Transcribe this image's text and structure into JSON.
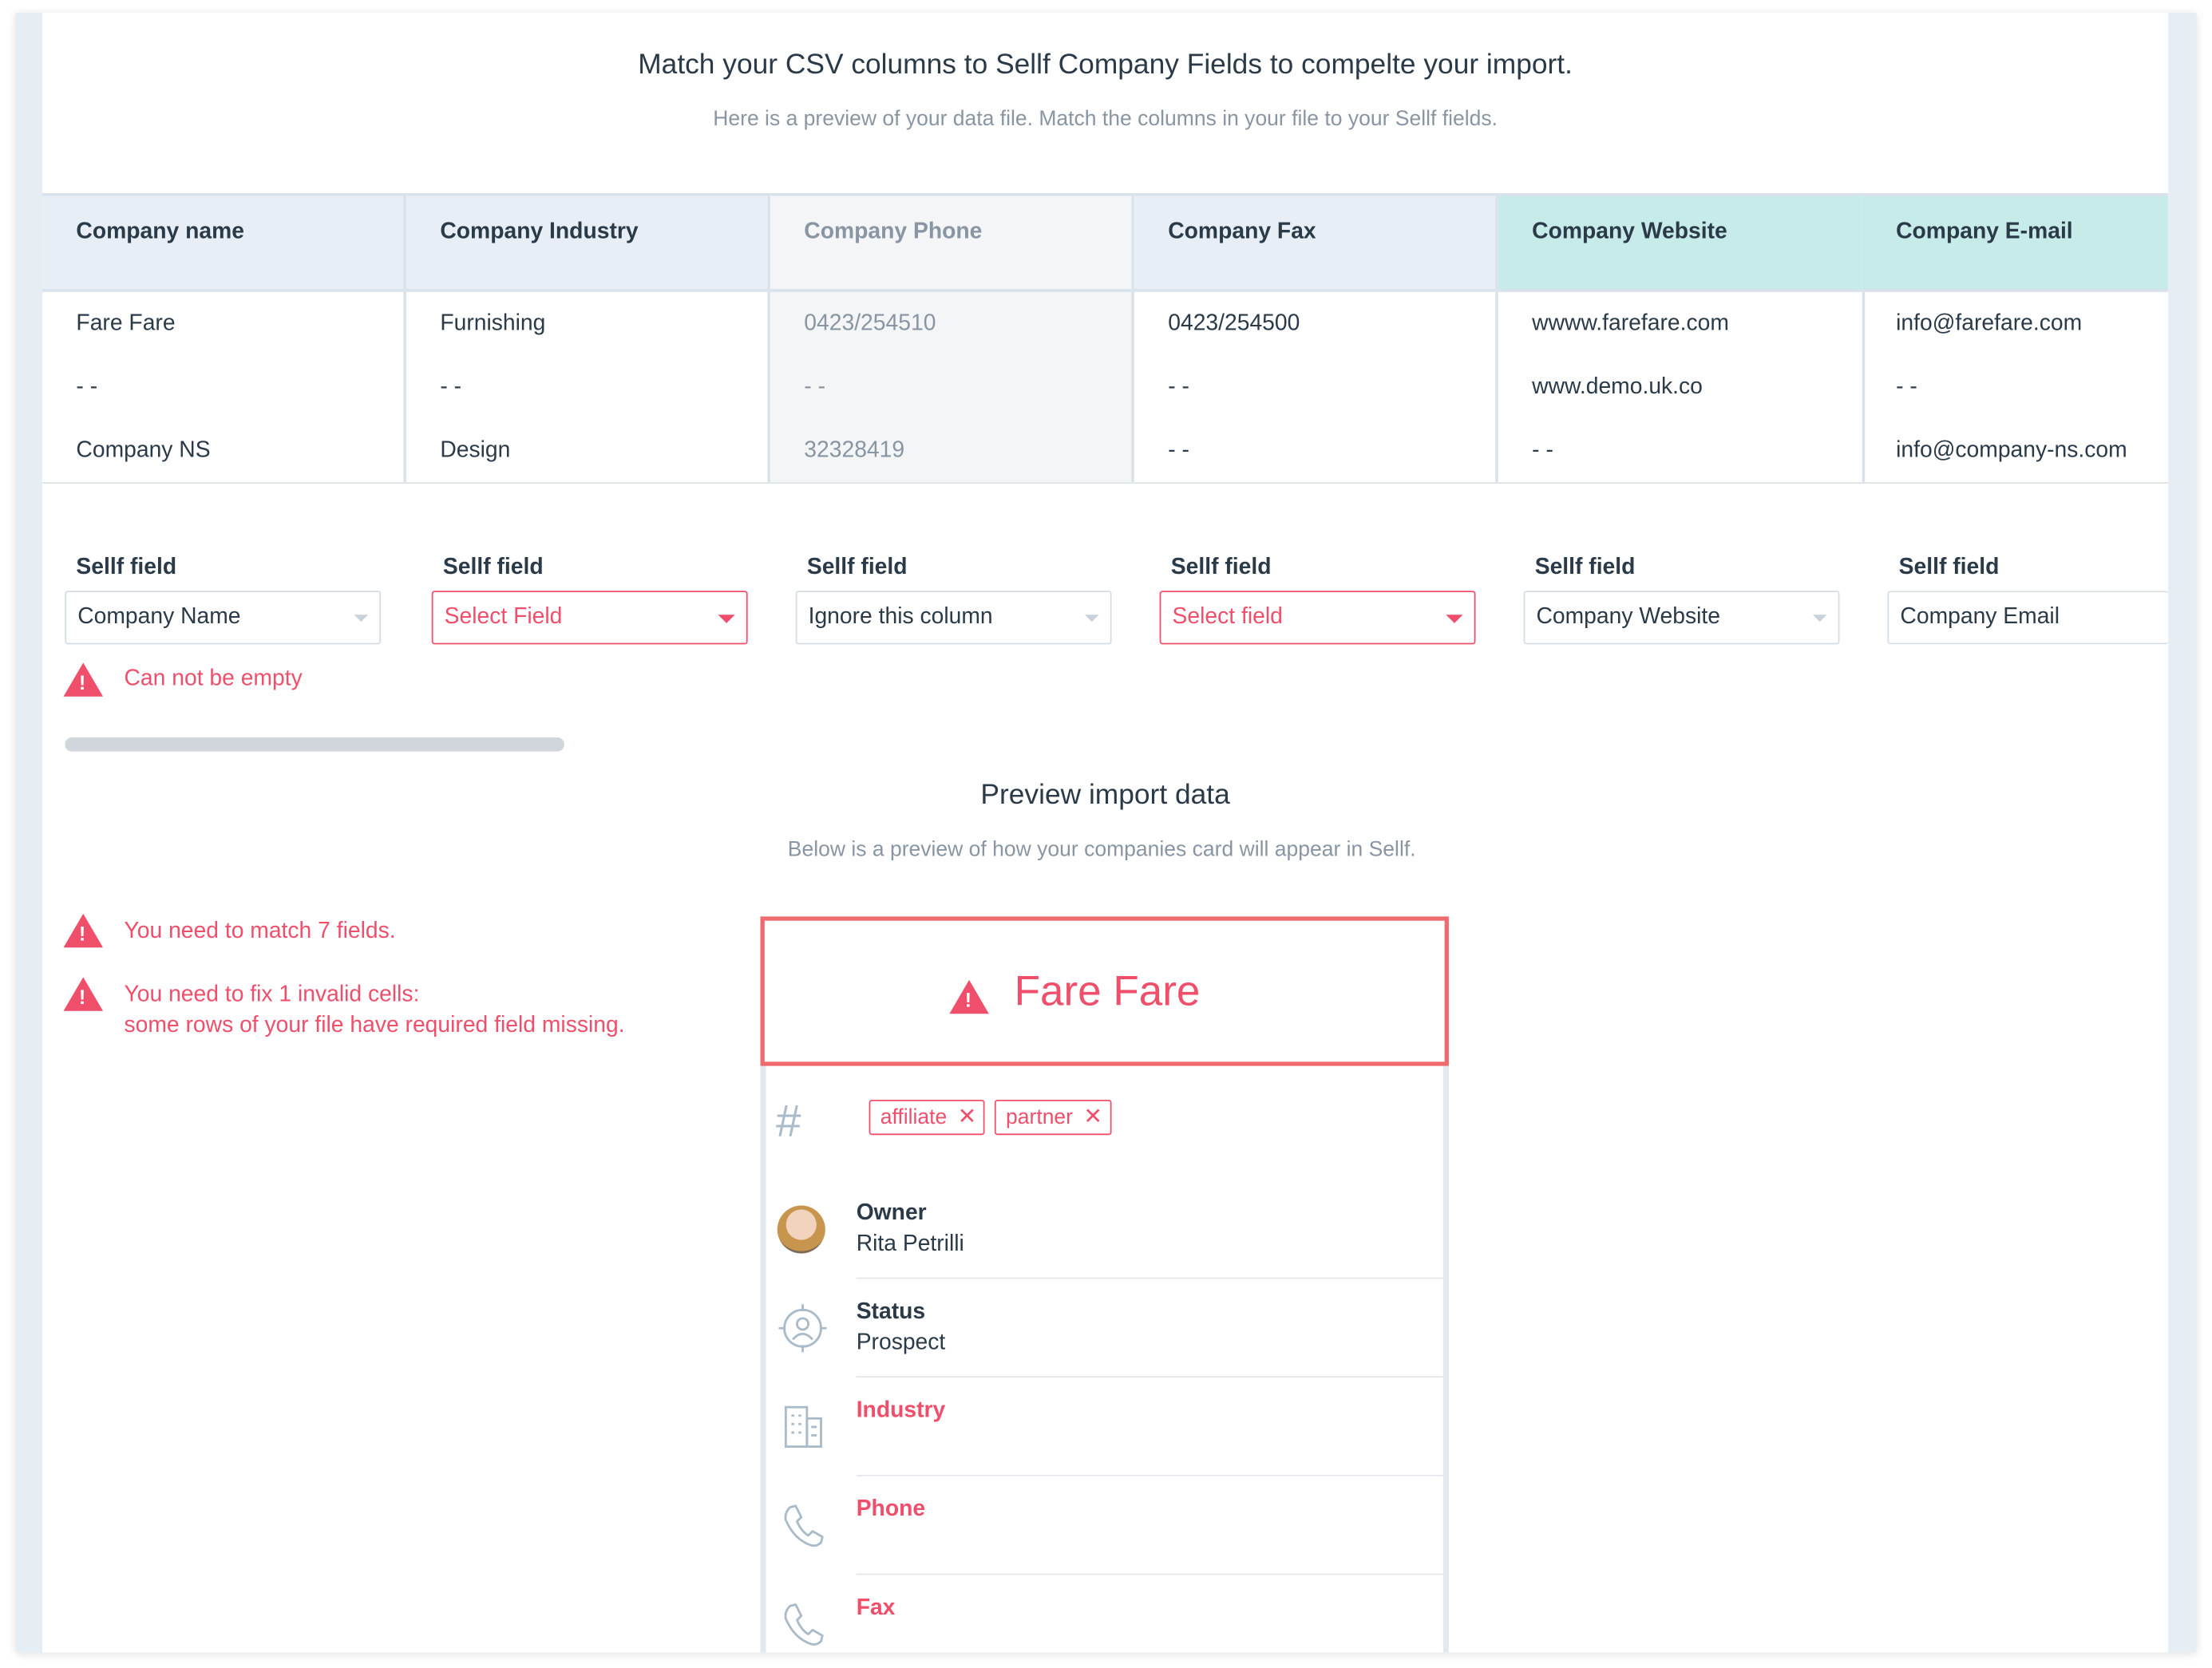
{
  "header": {
    "title": "Match your CSV columns to Sellf Company Fields to compelte your import.",
    "subtitle": "Here is a preview of your data file. Match the columns in your file to your Sellf fields."
  },
  "table": {
    "columns": [
      {
        "header": "Company name",
        "cells": [
          "Fare Fare",
          "- -",
          "Company NS"
        ]
      },
      {
        "header": "Company Industry",
        "cells": [
          "Furnishing",
          "- -",
          "Design"
        ]
      },
      {
        "header": "Company Phone",
        "cells": [
          "0423/254510",
          "- -",
          "32328419"
        ]
      },
      {
        "header": "Company Fax",
        "cells": [
          "0423/254500",
          "- -",
          "- -"
        ]
      },
      {
        "header": "Company Website",
        "cells": [
          "wwww.farefare.com",
          "www.demo.uk.co",
          "- -"
        ]
      },
      {
        "header": "Company E-mail",
        "cells": [
          "info@farefare.com",
          "- -",
          "info@company-ns.com"
        ]
      }
    ]
  },
  "mapping": {
    "label": "Sellf field",
    "selects": [
      "Company Name",
      "Select Field",
      "Ignore this column",
      "Select field",
      "Company Website",
      "Company Email"
    ],
    "error": "Can not be empty"
  },
  "preview": {
    "title": "Preview import data",
    "subtitle": "Below is a preview of how your companies card will appear in Sellf.",
    "errors": {
      "match": "You need to match  7 fields.",
      "fix_line1": "You need to fix 1 invalid cells:",
      "fix_line2": "some rows of your file have required field missing."
    }
  },
  "card": {
    "name": "Fare Fare",
    "tags": [
      "affiliate",
      "partner"
    ],
    "owner_label": "Owner",
    "owner_value": "Rita Petrilli",
    "status_label": "Status",
    "status_value": "Prospect",
    "industry_label": "Industry",
    "phone_label": "Phone",
    "fax_label": "Fax"
  },
  "colors": {
    "error": "#ef4f6b",
    "header_blue": "#e7eef5",
    "header_teal": "#c7ebe8",
    "header_grey": "#f3f5f7"
  }
}
